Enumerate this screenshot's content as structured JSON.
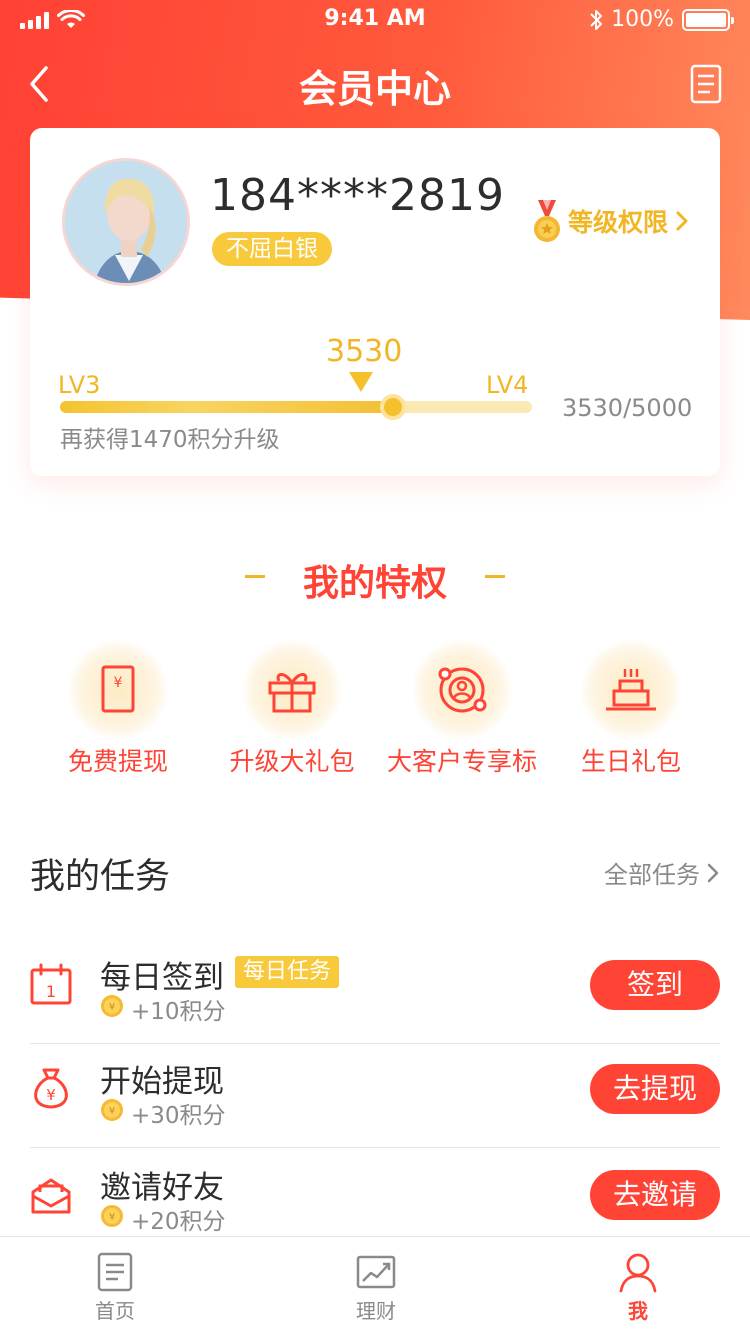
{
  "status_bar": {
    "time": "9:41 AM",
    "battery": "100%"
  },
  "nav": {
    "title": "会员中心"
  },
  "member": {
    "phone": "184****2819",
    "level_name": "不屈白银",
    "rights_link": "等级权限",
    "points": "3530",
    "level_from": "LV3",
    "level_to": "LV4",
    "progress_text": "3530/5000",
    "progress_fraction": 0.706,
    "upgrade_hint": "再获得1470积分升级"
  },
  "privileges": {
    "title": "我的特权",
    "items": [
      {
        "label": "免费提现",
        "icon": "withdraw-icon"
      },
      {
        "label": "升级大礼包",
        "icon": "gift-icon"
      },
      {
        "label": "大客户专享标",
        "icon": "vip-badge-icon"
      },
      {
        "label": "生日礼包",
        "icon": "cake-icon"
      }
    ]
  },
  "tasks": {
    "title": "我的任务",
    "all_link": "全部任务",
    "items": [
      {
        "name": "每日签到",
        "tag": "每日任务",
        "reward": "+10积分",
        "button": "签到",
        "icon": "calendar-icon"
      },
      {
        "name": "开始提现",
        "tag": "",
        "reward": "+30积分",
        "button": "去提现",
        "icon": "money-bag-icon"
      },
      {
        "name": "邀请好友",
        "tag": "",
        "reward": "+20积分",
        "button": "去邀请",
        "icon": "invite-envelope-icon"
      }
    ]
  },
  "tab_bar": {
    "items": [
      {
        "label": "首页",
        "icon": "home-doc-icon",
        "active": false
      },
      {
        "label": "理财",
        "icon": "chart-icon",
        "active": false
      },
      {
        "label": "我",
        "icon": "profile-icon",
        "active": true
      }
    ]
  },
  "colors": {
    "brand_red": "#ff4436",
    "gold": "#f1b624",
    "badge_yellow": "#f8c93a",
    "muted_text": "#8a8a8a"
  }
}
